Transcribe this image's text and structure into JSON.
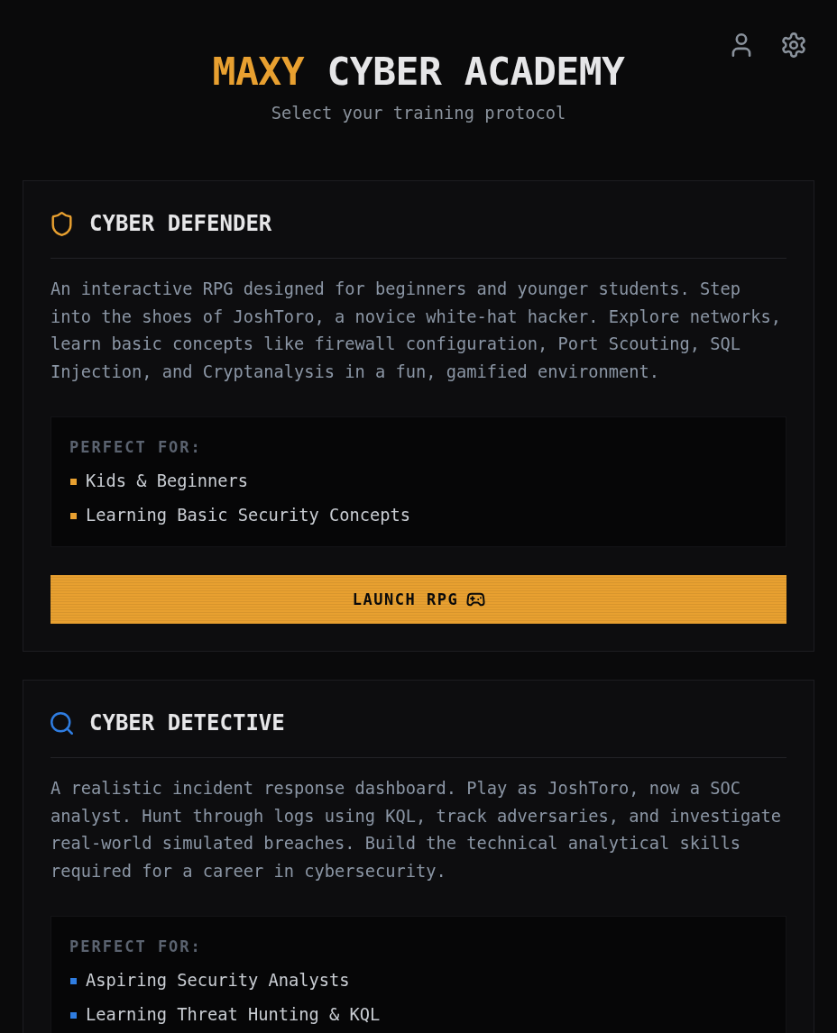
{
  "header": {
    "title_highlight": "MAXY",
    "title_rest": "CYBER ACADEMY",
    "subtitle": "Select your training protocol"
  },
  "cards": [
    {
      "title": "CYBER DEFENDER",
      "color": "#e8a030",
      "description": "An interactive RPG designed for beginners and younger students. Step into the shoes of JoshToro, a novice white-hat hacker. Explore networks, learn basic concepts like firewall configuration, Port Scouting, SQL Injection, and Cryptanalysis in a fun, gamified environment.",
      "audience_label": "PERFECT FOR:",
      "audience": [
        "Kids & Beginners",
        "Learning Basic Security Concepts"
      ],
      "button": {
        "label": "LAUNCH RPG"
      }
    },
    {
      "title": "CYBER DETECTIVE",
      "color": "#2f7de1",
      "description": "A realistic incident response dashboard. Play as JoshToro, now a SOC analyst. Hunt through logs using KQL, track adversaries, and investigate real-world simulated breaches. Build the technical analytical skills required for a career in cybersecurity.",
      "audience_label": "PERFECT FOR:",
      "audience": [
        "Aspiring Security Analysts",
        "Learning Threat Hunting & KQL"
      ]
    }
  ]
}
